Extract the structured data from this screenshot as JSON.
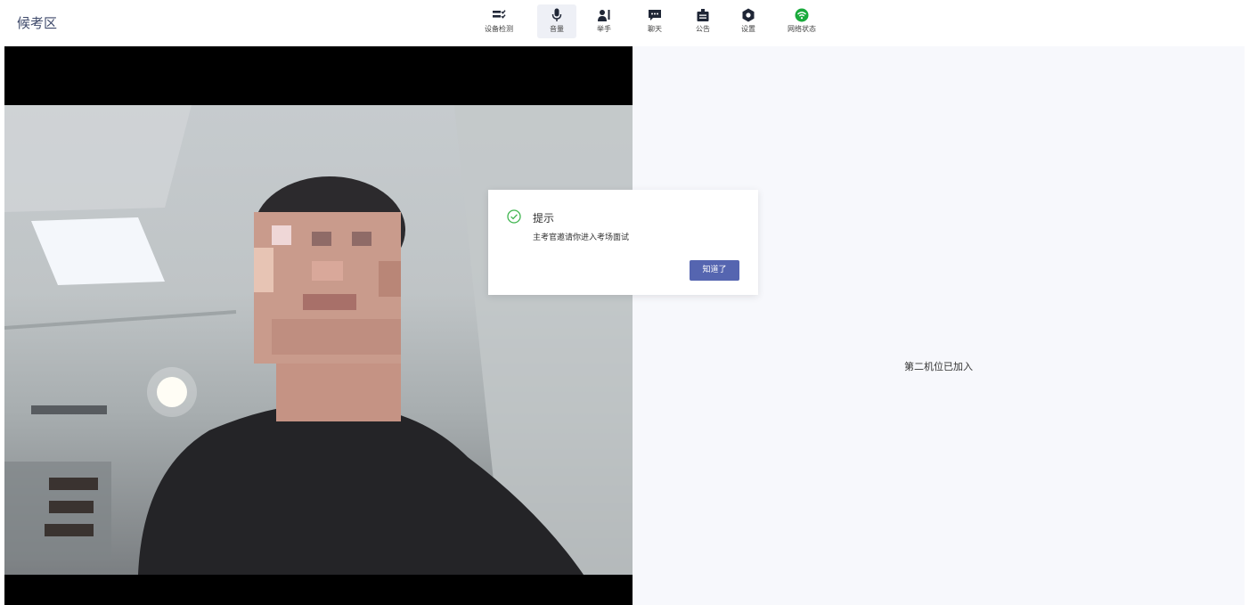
{
  "header": {
    "title": "候考区"
  },
  "toolbar": {
    "items": [
      {
        "label": "设备检测",
        "icon": "device-check-icon"
      },
      {
        "label": "音量",
        "icon": "microphone-icon",
        "active": true
      },
      {
        "label": "举手",
        "icon": "raise-hand-icon"
      },
      {
        "label": "聊天",
        "icon": "chat-icon"
      },
      {
        "label": "公告",
        "icon": "announcement-icon"
      },
      {
        "label": "设置",
        "icon": "settings-icon"
      },
      {
        "label": "网络状态",
        "icon": "wifi-icon",
        "color": "#1aaa3c"
      }
    ]
  },
  "right_panel": {
    "status": "第二机位已加入"
  },
  "dialog": {
    "title": "提示",
    "message": "主考官邀请你进入考场面试",
    "button": "知道了",
    "icon": "check-circle-icon",
    "icon_color": "#3fb54f",
    "button_color": "#5565b0"
  }
}
